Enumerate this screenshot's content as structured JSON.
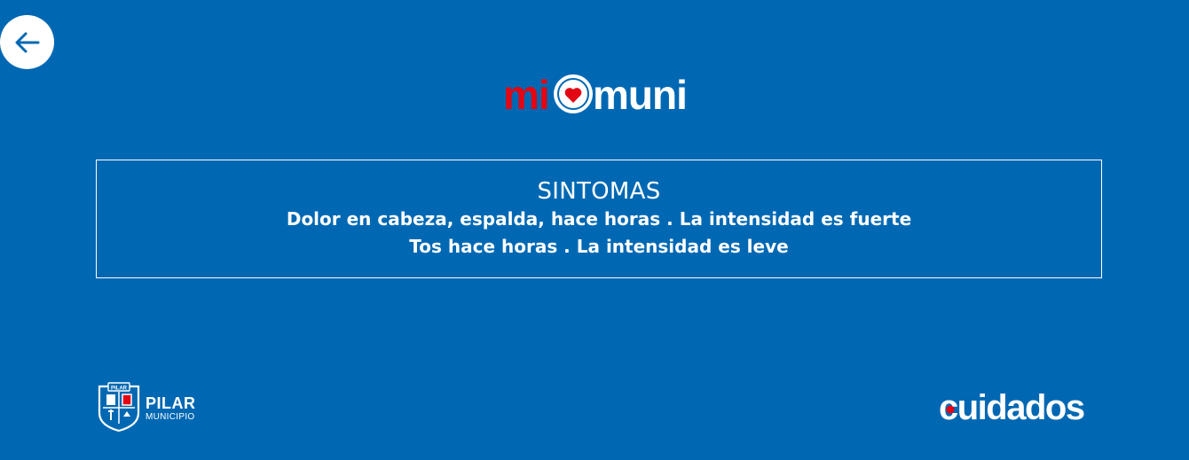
{
  "header": {
    "back_icon": "arrow-left-icon",
    "logo": {
      "text_mi": "mi",
      "text_muni": "muni",
      "accent": "#e30613",
      "heart_icon": "heart-icon"
    }
  },
  "symptoms": {
    "title": "SINTOMAS",
    "lines": [
      "Dolor en cabeza, espalda, hace horas . La intensidad es fuerte",
      "Tos hace horas . La intensidad es leve"
    ]
  },
  "footer": {
    "pilar": {
      "name": "PILAR",
      "subtitle": "MUNICIPIO",
      "crest_text": "PILAR",
      "icon": "crest-icon"
    },
    "cuidados": {
      "text": "cuidados",
      "dot_color": "#e30613"
    }
  },
  "colors": {
    "background": "#0068b3",
    "accent_red": "#e30613",
    "text": "#ffffff"
  }
}
